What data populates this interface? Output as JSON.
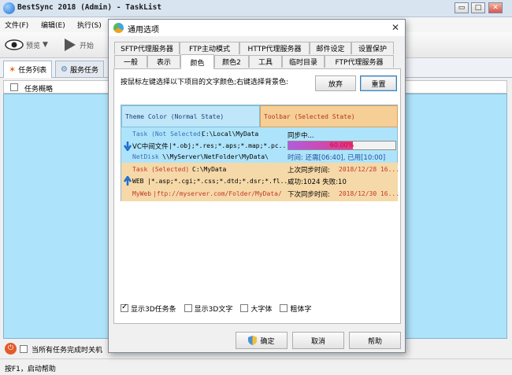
{
  "window": {
    "title": "BestSync 2018 (Admin) - TaskList",
    "controls": [
      "▭",
      "□",
      "✕"
    ]
  },
  "menu": [
    "文件(F)",
    "编辑(E)",
    "执行(S)"
  ],
  "toolbar": {
    "preview": "预览",
    "start": "开始"
  },
  "main_tabs": [
    "任务列表",
    "服务任务"
  ],
  "list": {
    "header": "任务概略"
  },
  "bottom": {
    "shutdown_label": "当所有任务完成时关机"
  },
  "status": {
    "text": "按F1，启动帮助"
  },
  "dialog": {
    "title": "通用选项",
    "tabs_row1": [
      "SFTP代理服务器",
      "FTP主动模式",
      "HTTP代理服务器",
      "邮件设定",
      "设置保护"
    ],
    "tabs_row2": [
      "一般",
      "表示",
      "颜色",
      "颜色2",
      "工具",
      "临时目录",
      "FTP代理服务器"
    ],
    "active_tab": "颜色",
    "instruction": "按鼠标左键选择以下项目的文字颜色;右键选择背景色:",
    "discard": "放弃",
    "reset": "重置",
    "ok": "确定",
    "cancel": "取消",
    "help": "帮助",
    "preview": {
      "theme_normal": "Theme Color (Normal State)",
      "theme_selected": "Toolbar (Selected State)",
      "task_normal": "Task (Not Selected)",
      "path_local": "C:\\Local\\MyData",
      "sync_status": "同步中...",
      "vc_label": "VC中间文件",
      "vc_filter": "|*.obj;*.res;*.aps;*.map;*.pc...",
      "progress_value": 0.6,
      "progress_text": "60.00%",
      "netdisk_label": "NetDisk",
      "netdisk_path": "\\\\MyServer\\NetFolder\\MyData\\",
      "time_text": "时间: 还需[06:40], 已用[10:00]",
      "task_selected": "Task (Selected)",
      "path_selected": "C:\\MyData",
      "last_sync_label": "上次同步时间:",
      "last_sync_value": "2018/12/28 16...",
      "web_label": "WEB",
      "web_filter": "|*.asp;*.cgi;*.css;*.dtd;*.dsr;*.fl...",
      "success_text": "成功:1024 失败:10",
      "myweb_label": "MyWeb",
      "myweb_path": "|ftp://myserver.com/Folder/MyData/",
      "next_sync_label": "下次同步时间:",
      "next_sync_value": "2018/12/30 16..."
    },
    "options": [
      {
        "label": "显示3D任务条",
        "checked": true
      },
      {
        "label": "显示3D文字",
        "checked": false
      },
      {
        "label": "大字体",
        "checked": false
      },
      {
        "label": "粗体字",
        "checked": false
      }
    ]
  },
  "colors": {
    "list_bg": "#aee4fb",
    "task_normal_text": "#3d6fb5",
    "task_selected_text": "#c0392b",
    "selected_bg": "#f6d9a8",
    "progress_text": "#e7002b"
  }
}
